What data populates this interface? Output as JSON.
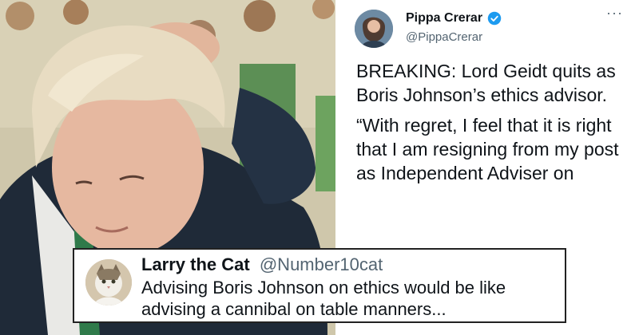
{
  "tweet": {
    "author_name": "Pippa Crerar",
    "author_handle": "@PippaCrerar",
    "menu_label": "···",
    "paragraphs": [
      "BREAKING: Lord Geidt quits as Boris Johnson’s ethics advisor.",
      "“With regret, I feel that it is right that I am resigning from my post as Independent Adviser on"
    ]
  },
  "quote": {
    "author_name": "Larry the Cat",
    "author_handle": "@Number10cat",
    "text": "Advising Boris Johnson on ethics would be like advising a cannibal on table manners..."
  },
  "colors": {
    "verified": "#1d9bf0",
    "text": "#0f1419",
    "muted": "#536471"
  }
}
